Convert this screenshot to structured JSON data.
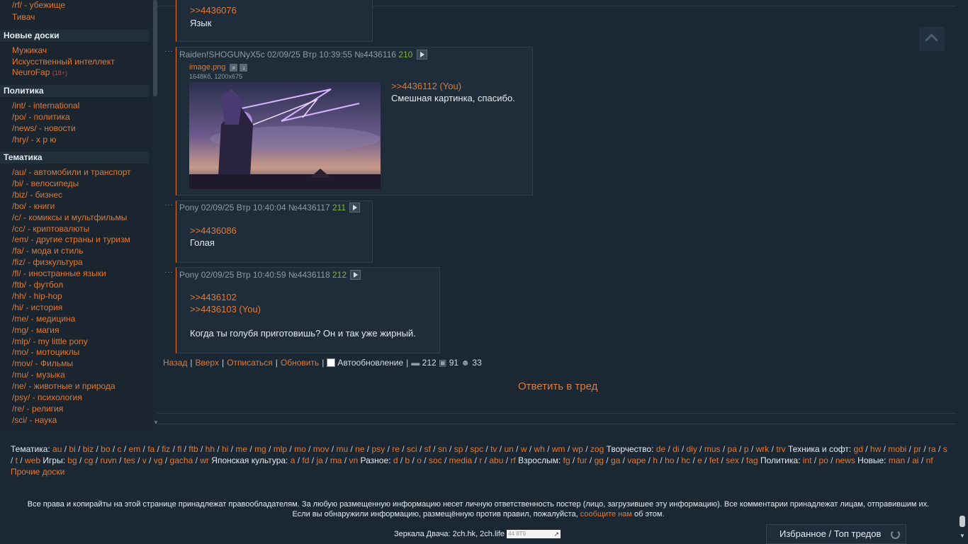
{
  "sidebar": {
    "partial_top": "/rf/ - убежище",
    "partial_top2": "Тивач",
    "sections": [
      {
        "title": "Новые доски",
        "boards": [
          {
            "label": "Мужикач"
          },
          {
            "label": "Искусственный интеллект"
          },
          {
            "label": "NeuroFap",
            "badge": "(18+)"
          }
        ]
      },
      {
        "title": "Политика",
        "boards": [
          {
            "label": "/int/ - international"
          },
          {
            "label": "/po/ - политика"
          },
          {
            "label": "/news/ - новости"
          },
          {
            "label": "/hry/ - х р ю"
          }
        ]
      },
      {
        "title": "Тематика",
        "boards": [
          {
            "label": "/au/ - автомобили и транспорт"
          },
          {
            "label": "/bi/ - велосипеды"
          },
          {
            "label": "/biz/ - бизнес"
          },
          {
            "label": "/bo/ - книги"
          },
          {
            "label": "/c/ - комиксы и мультфильмы"
          },
          {
            "label": "/cc/ - криптовалюты"
          },
          {
            "label": "/em/ - другие страны и туризм"
          },
          {
            "label": "/fa/ - мода и стиль"
          },
          {
            "label": "/fiz/ - физкультура"
          },
          {
            "label": "/fl/ - иностранные языки"
          },
          {
            "label": "/ftb/ - футбол"
          },
          {
            "label": "/hh/ - hip-hop"
          },
          {
            "label": "/hi/ - история"
          },
          {
            "label": "/me/ - медицина"
          },
          {
            "label": "/mg/ - магия"
          },
          {
            "label": "/mlp/ - my little pony"
          },
          {
            "label": "/mo/ - мотоциклы"
          },
          {
            "label": "/mov/ - Фильмы"
          },
          {
            "label": "/mu/ - музыка"
          },
          {
            "label": "/ne/ - животные и природа"
          },
          {
            "label": "/psy/ - психология"
          },
          {
            "label": "/re/ - религия"
          },
          {
            "label": "/sci/ - наука"
          }
        ]
      }
    ]
  },
  "posts": [
    {
      "reply_ref": ">>4436076",
      "text": "Язык"
    },
    {
      "name": "Raiden!SHOGUNyX5c",
      "date": "02/09/25 Втр 10:39:55",
      "num": "№4436116",
      "count": "210",
      "file_name": "image.png",
      "file_info": "1648Кб, 1200x675",
      "reply_ref": ">>4436112 (You)",
      "text": "Смешная картинка, спасибо."
    },
    {
      "name": "Pony",
      "date": "02/09/25 Втр 10:40:04",
      "num": "№4436117",
      "count": "211",
      "reply_ref": ">>4436086",
      "text": "Голая"
    },
    {
      "name": "Pony",
      "date": "02/09/25 Втр 10:40:59",
      "num": "№4436118",
      "count": "212",
      "reply_ref": ">>4436102",
      "reply_ref2": ">>4436103 (You)",
      "text": "Когда ты голубя приготовишь? Он и так уже жирный."
    }
  ],
  "thread_nav": {
    "back": "Назад",
    "up": "Вверх",
    "unsubscribe": "Отписаться",
    "refresh": "Обновить",
    "autoupdate": "Автообновление",
    "posts_count": "212",
    "images_count": "91",
    "users_count": "33"
  },
  "reply_button": "Ответить в тред",
  "boardlist_html_segments": [
    {
      "label": "Тематика:",
      "boards": [
        "au",
        "bi",
        "biz",
        "bo",
        "c",
        "em",
        "fa",
        "fiz",
        "fl",
        "ftb",
        "hh",
        "hi",
        "me",
        "mg",
        "mlp",
        "mo",
        "mov",
        "mu",
        "ne",
        "psy",
        "re",
        "sci",
        "sf",
        "sn",
        "sp",
        "spc",
        "tv",
        "un",
        "w",
        "wh",
        "wm",
        "wp",
        "zog"
      ]
    },
    {
      "label": "Творчество:",
      "boards": [
        "de",
        "di",
        "diy",
        "mus",
        "pa",
        "p",
        "wrk",
        "trv"
      ]
    },
    {
      "label": "Техника и софт:",
      "boards": [
        "gd",
        "hw",
        "mobi",
        "pr",
        "ra",
        "s",
        "t",
        "web"
      ]
    },
    {
      "label": "Игры:",
      "boards": [
        "bg",
        "cg",
        "ruvn",
        "tes",
        "v",
        "vg",
        "gacha",
        "wr"
      ]
    },
    {
      "label": "Японская культура:",
      "boards": [
        "a",
        "fd",
        "ja",
        "ma",
        "vn"
      ]
    },
    {
      "label": "Разное:",
      "boards": [
        "d",
        "b",
        "o",
        "soc",
        "media",
        "r",
        "abu",
        "rf"
      ]
    },
    {
      "label": "Взрослым:",
      "boards": [
        "fg",
        "fur",
        "gg",
        "ga",
        "vape",
        "h",
        "ho",
        "hc",
        "e",
        "fet",
        "sex",
        "fag"
      ]
    },
    {
      "label": "Политика:",
      "boards": [
        "int",
        "po",
        "news"
      ]
    },
    {
      "label": "Новые:",
      "boards": [
        "man",
        "ai",
        "nf"
      ]
    }
  ],
  "other_boards": "Прочие доски",
  "footer": {
    "copyright_line1": "Все права и копирайты на этой странице принадлежат правообладателям. За любую размещенную информацию несет личную ответственность постер (лицо, загрузившее эту информацию). Все комментарии принадлежат лицам, отправившим их.",
    "copyright_line2_pre": "Если вы обнаружили информацию, размещённую против правил, пожалуйста,",
    "copyright_link": "сообщите нам",
    "copyright_line2_post": "об этом.",
    "mirrors_label": "Зеркала Двача: 2ch.hk, 2ch.life",
    "mirror_input_placeholder": "44 8Т9"
  },
  "favorites_button": "Избранное / Топ тредов",
  "colors": {
    "accent": "#e07a34",
    "background": "#1b2733",
    "post_bg": "#1f2c39",
    "count_green": "#7cb342"
  }
}
